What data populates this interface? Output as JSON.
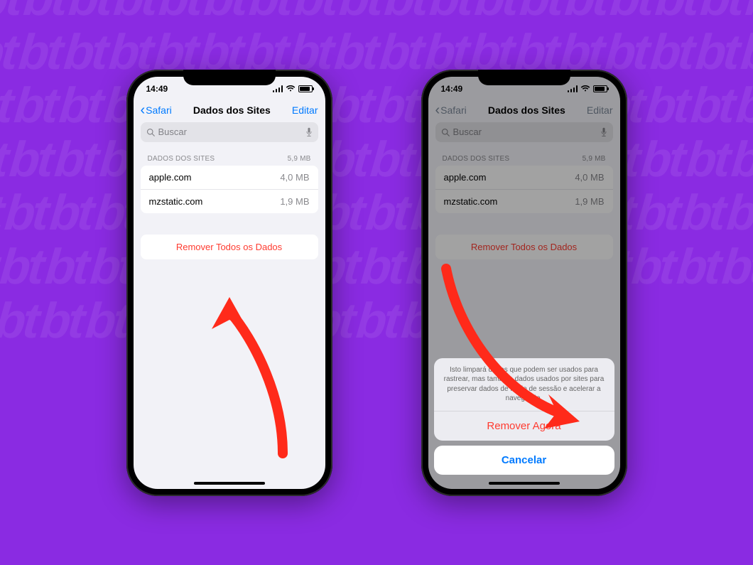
{
  "status": {
    "time": "14:49"
  },
  "nav": {
    "back": "Safari",
    "title": "Dados dos Sites",
    "edit": "Editar"
  },
  "search": {
    "placeholder": "Buscar"
  },
  "section": {
    "header": "DADOS DOS SITES",
    "total": "5,9 MB"
  },
  "sites": [
    {
      "domain": "apple.com",
      "size": "4,0 MB"
    },
    {
      "domain": "mzstatic.com",
      "size": "1,9 MB"
    }
  ],
  "removeAll": "Remover Todos os Dados",
  "sheet": {
    "message": "Isto limpará dados que podem ser usados para rastrear, mas também dados usados por sites para preservar dados de início de sessão e acelerar a navegação.",
    "remove": "Remover Agora",
    "cancel": "Cancelar"
  }
}
